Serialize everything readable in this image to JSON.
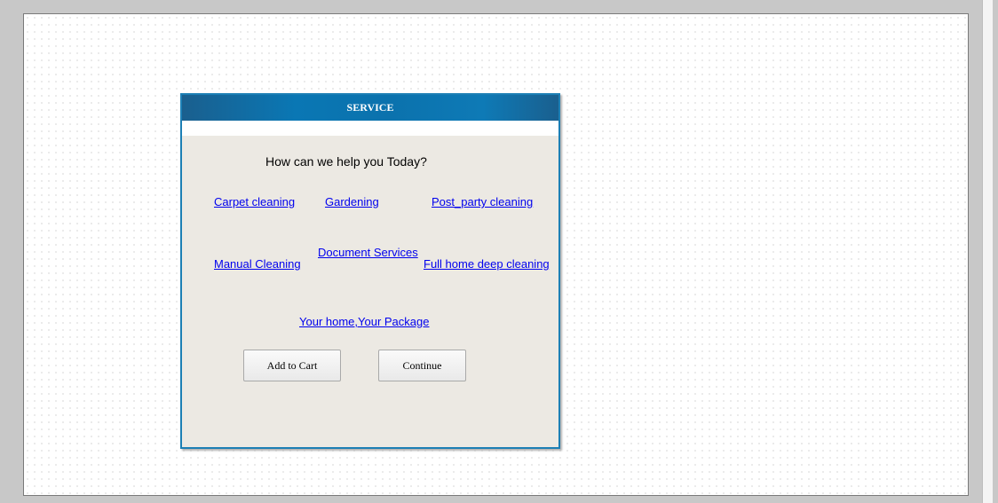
{
  "panel": {
    "title": "SERVICE",
    "prompt": "How can we help you Today?"
  },
  "services": {
    "carpet_cleaning": "Carpet cleaning",
    "gardening": "Gardening",
    "post_party_cleaning": "Post_party cleaning",
    "manual_cleaning": "Manual Cleaning",
    "document_services": "Document Services",
    "full_home_deep_cleaning": "Full home deep cleaning",
    "your_home_package": "Your home,Your Package"
  },
  "buttons": {
    "add_to_cart": "Add to Cart",
    "continue": "Continue"
  },
  "colors": {
    "header_blue": "#0a77b4",
    "panel_border": "#1c7fb5",
    "panel_bg": "#ece9e3",
    "link": "#0000ee"
  }
}
